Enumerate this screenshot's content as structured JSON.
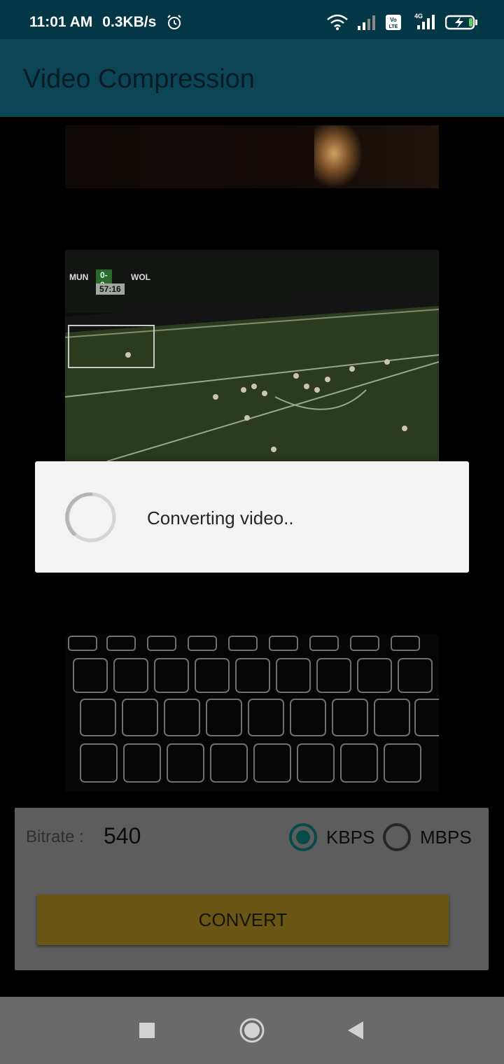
{
  "status_bar": {
    "time": "11:01 AM",
    "speed": "0.3KB/s",
    "icons": [
      "alarm-icon",
      "wifi-icon",
      "signal-icon",
      "volte-icon",
      "4g-signal-icon",
      "battery-charging-icon"
    ],
    "volte_label": "Vo LTE",
    "network_label": "4G"
  },
  "app_bar": {
    "title": "Video Compression"
  },
  "video": {
    "score": {
      "home": "MUN",
      "score": "0-0",
      "time": "57:16",
      "away": "WOL"
    }
  },
  "dialog": {
    "message": "Converting video.."
  },
  "panel": {
    "bitrate_label": "Bitrate :",
    "bitrate_value": "540",
    "unit_options": [
      "KBPS",
      "MBPS"
    ],
    "selected_unit": "KBPS",
    "convert_label": "CONVERT"
  },
  "nav_bar": {
    "icons": [
      "recents-square-icon",
      "home-circle-icon",
      "back-triangle-icon"
    ]
  },
  "colors": {
    "status_bar": "#043746",
    "app_bar": "#0c4656",
    "convert_button": "#6a5614",
    "radio_accent": "#074a48",
    "dialog_bg": "#f3f3f3"
  }
}
